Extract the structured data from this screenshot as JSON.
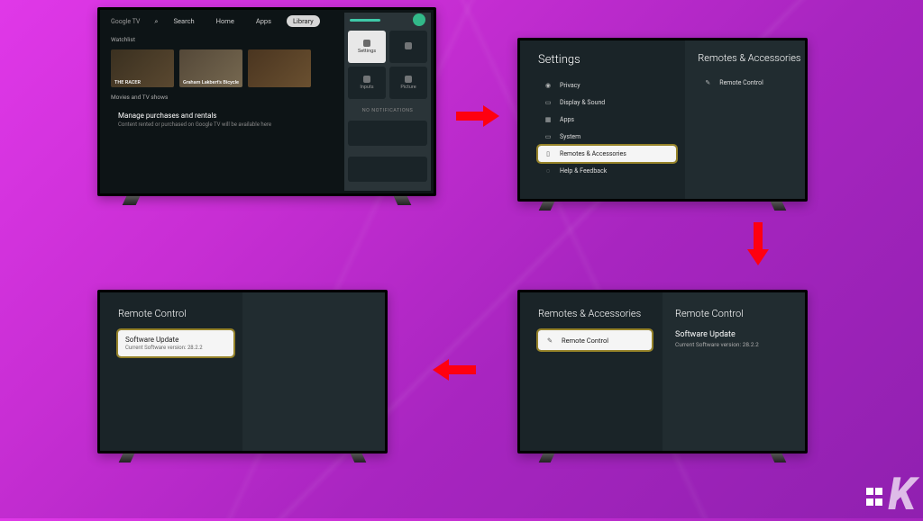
{
  "tv1": {
    "logo": "Google TV",
    "tabs": [
      "Search",
      "Home",
      "Apps",
      "Library"
    ],
    "active_tab": "Library",
    "section1_label": "Watchlist",
    "tile1_label": "THE RACER",
    "tile2_label": "Graham Lakbert's Bicycle",
    "section2_label": "Movies and TV shows",
    "manage_title": "Manage purchases and rentals",
    "manage_sub": "Content rented or purchased on Google TV will be available here",
    "panel_cells": [
      "Settings",
      "",
      "Inputs",
      "Picture"
    ],
    "no_notif": "NO NOTIFICATIONS"
  },
  "tv2": {
    "left_title": "Settings",
    "items": [
      {
        "icon": "shield",
        "label": "Privacy"
      },
      {
        "icon": "display",
        "label": "Display & Sound"
      },
      {
        "icon": "apps",
        "label": "Apps"
      },
      {
        "icon": "system",
        "label": "System"
      },
      {
        "icon": "remote",
        "label": "Remotes & Accessories"
      },
      {
        "icon": "help",
        "label": "Help & Feedback"
      }
    ],
    "selected_index": 4,
    "right_title": "Remotes & Accessories",
    "right_item": "Remote Control"
  },
  "tv3": {
    "left_title": "Remotes & Accessories",
    "item_label": "Remote Control",
    "right_title": "Remote Control",
    "detail_title": "Software Update",
    "detail_sub": "Current Software version: 28.2.2"
  },
  "tv4": {
    "left_title": "Remote Control",
    "item_title": "Software Update",
    "item_sub": "Current Software version: 28.2.2"
  },
  "watermark": "K"
}
